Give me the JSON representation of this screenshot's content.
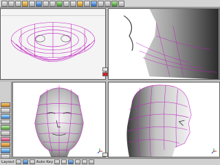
{
  "status_bar": {
    "mode_text": "Layout",
    "info_text": "Auto Key"
  },
  "colors": {
    "wireframe": "#c020c0",
    "head_shade": "#8c8c8c",
    "accent_red": "#d02020"
  },
  "icons": {
    "nav_gizmo": "axis-tripod-icon",
    "toolbar": [
      "new-icon",
      "open-icon",
      "save-icon",
      "undo-icon",
      "redo-icon",
      "select-icon",
      "move-icon",
      "rotate-icon",
      "scale-icon",
      "render-icon"
    ]
  }
}
